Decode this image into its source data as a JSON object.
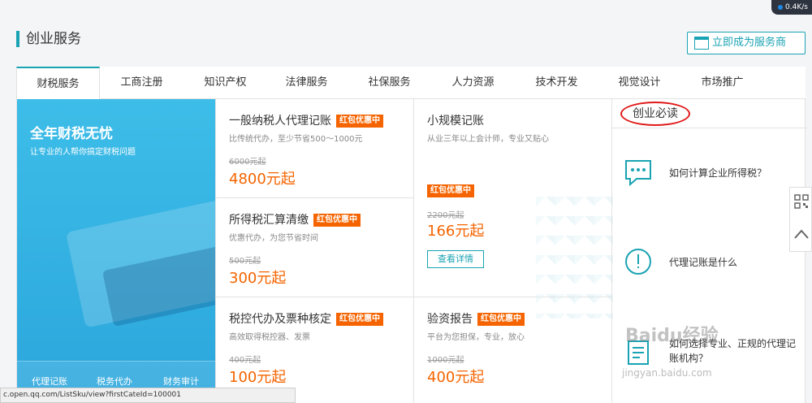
{
  "speed": "0.4K/s",
  "section_title": "创业服务",
  "become_provider_label": "立即成为服务商",
  "tabs": [
    "财税服务",
    "工商注册",
    "知识产权",
    "法律服务",
    "社保服务",
    "人力资源",
    "技术开发",
    "视觉设计",
    "市场推广"
  ],
  "banner": {
    "title": "全年财税无忧",
    "subtitle": "让专业的人帮你搞定财税问题",
    "links": [
      "代理记账",
      "税务代办",
      "财务审计"
    ]
  },
  "products": [
    {
      "name": "一般纳税人代理记账",
      "badge": "红包优惠中",
      "desc": "比传统代办，至少节省500～1000元",
      "old": "6000元起",
      "price": "4800元起"
    },
    {
      "name": "所得税汇算清缴",
      "badge": "红包优惠中",
      "desc": "优惠代办，为您节省时间",
      "old": "500元起",
      "price": "300元起"
    },
    {
      "name": "税控代办及票种核定",
      "badge": "红包优惠中",
      "desc": "高效取得税控器、发票",
      "old": "400元起",
      "price": "100元起"
    },
    {
      "name": "小规模记账",
      "badge": "红包优惠中",
      "desc": "从业三年以上会计师，专业又贴心",
      "old": "2200元起",
      "price": "166元起",
      "button": "查看详情"
    },
    {
      "name": "验资报告",
      "badge": "红包优惠中",
      "desc": "平台为您担保，专业，放心",
      "old": "1000元起",
      "price": "400元起"
    }
  ],
  "reads": {
    "title": "创业必读",
    "items": [
      "如何计算企业所得税？",
      "代理记账是什么",
      "如何选择专业、正规的代理记账机构？"
    ]
  },
  "status_url": "c.open.qq.com/ListSku/view?firstCateId=100001",
  "watermark": "Baidu经验",
  "watermark_url": "jingyan.baidu.com",
  "colors": {
    "accent": "#1aa3b3",
    "price": "#f56400",
    "badge": "#f56400",
    "circle": "#e01818"
  }
}
